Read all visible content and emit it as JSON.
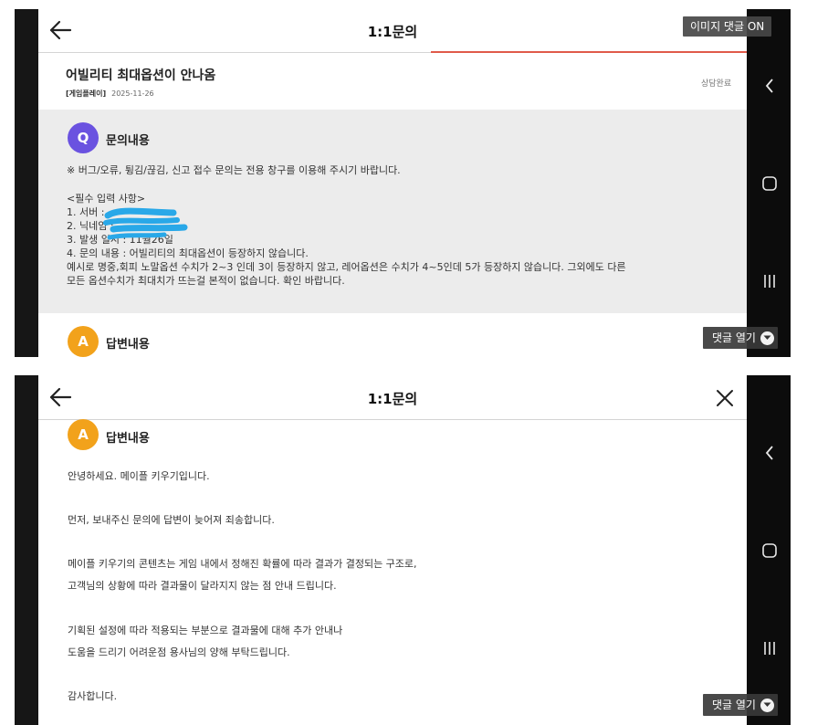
{
  "colors": {
    "frame": "#161616",
    "q_panel": "#ececec",
    "badge_q": "#6a52e0",
    "badge_a": "#f2a21b",
    "accent_line": "#e05a4a",
    "redaction": "#29a8e8"
  },
  "top": {
    "header_title": "1:1문의",
    "back_icon": "arrow-left-icon",
    "overlay_label": "이미지 댓글 ON",
    "inquiry": {
      "title": "어빌리티 최대옵션이 안나옴",
      "category": "[게임플레이]",
      "date": "2025-11-26",
      "status": "상담완료"
    },
    "question_label": "문의내용",
    "question_badge": "Q",
    "question_lines": [
      "※ 버그/오류, 튕김/끊김, 신고 접수 문의는 전용 창구를 이용해 주시기 바랍니다.",
      "",
      "<필수 입력 사항>",
      "1. 서버 :",
      "2. 닉네임 :",
      "3. 발생 일시 : 11월26일",
      "4. 문의 내용 : 어빌리티의 최대옵션이 등장하지 않습니다.",
      "예시로 명중,회피 노말옵션 수치가 2~3 인데 3이 등장하지 않고, 레어옵션은 수치가 4~5인데 5가 등장하지 않습니다. 그외에도 다른",
      "모든 옵션수치가 최대치가 뜨는걸 본적이 없습니다. 확인 바랍니다."
    ],
    "answer_label": "답변내용",
    "answer_badge": "A",
    "comment_chip": "댓글 열기"
  },
  "bottom": {
    "header_title": "1:1문의",
    "back_icon": "arrow-left-icon",
    "close_icon": "close-icon",
    "answer_label": "답변내용",
    "answer_badge": "A",
    "answer_paragraphs": [
      [
        "안녕하세요. 메이플 키우기입니다."
      ],
      [
        "먼저, 보내주신 문의에 답변이 늦어져 죄송합니다."
      ],
      [
        "메이플 키우기의 콘텐츠는 게임 내에서 정해진 확률에 따라 결과가 결정되는 구조로,",
        "고객님의 상황에 따라 결과물이 달라지지 않는 점 안내 드립니다."
      ],
      [
        "기획된 설정에 따라 적용되는 부분으로 결과물에 대해 추가 안내나",
        "도움을 드리기 어려운점 용사님의 양해 부탁드립니다."
      ],
      [
        "감사합니다."
      ]
    ],
    "comment_chip": "댓글 열기"
  },
  "side_nav": {
    "back": "chevron-left-icon",
    "home": "home-square-icon",
    "recents": "recents-icon"
  }
}
